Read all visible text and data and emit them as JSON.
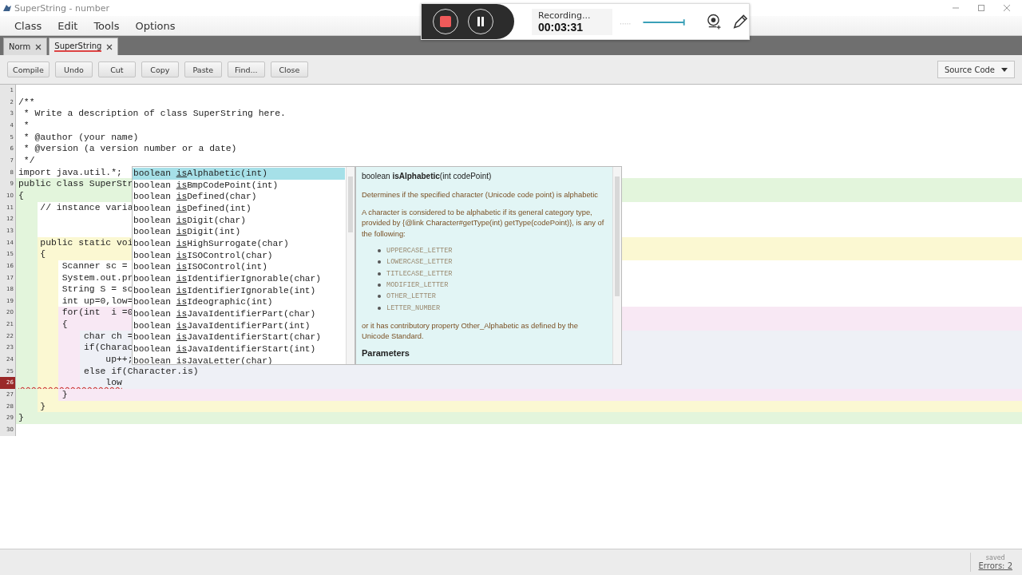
{
  "window": {
    "title": "SuperString - number"
  },
  "menu": [
    "Class",
    "Edit",
    "Tools",
    "Options"
  ],
  "tabs": [
    {
      "label": "Norm",
      "selected": false
    },
    {
      "label": "SuperString",
      "selected": true
    }
  ],
  "toolbar": {
    "buttons": [
      "Compile",
      "Undo",
      "Cut",
      "Copy",
      "Paste",
      "Find...",
      "Close"
    ],
    "view_selector": "Source Code"
  },
  "recorder": {
    "status": "Recording...",
    "time": "00:03:31",
    "paused": false
  },
  "editor": {
    "lines": [
      {
        "number": "1",
        "kind": "plain",
        "error": false
      },
      {
        "number": "2",
        "text": "/**",
        "kind": "plain",
        "error": false
      },
      {
        "number": "3",
        "text": " * Write a description of class SuperString here.",
        "kind": "plain",
        "error": false
      },
      {
        "number": "4",
        "text": " *",
        "kind": "plain",
        "error": false
      },
      {
        "number": "5",
        "text": " * @author (your name)",
        "kind": "plain",
        "error": false
      },
      {
        "number": "6",
        "text": " * @version (a version number or a date)",
        "kind": "plain",
        "error": false
      },
      {
        "number": "7",
        "text": " */",
        "kind": "plain",
        "error": false
      },
      {
        "number": "8",
        "text": "import java.util.*;",
        "kind": "plain",
        "error": false
      },
      {
        "number": "9",
        "text": "public class SuperStr",
        "kind": "class",
        "error": false
      },
      {
        "number": "10",
        "text": "{",
        "kind": "class",
        "error": false
      },
      {
        "number": "11",
        "text": "    // instance varia",
        "kind": "field",
        "error": false
      },
      {
        "number": "12",
        "kind": "field",
        "error": false
      },
      {
        "number": "13",
        "kind": "field",
        "error": false
      },
      {
        "number": "14",
        "text": "    public static voi",
        "kind": "method",
        "error": false
      },
      {
        "number": "15",
        "text": "    {",
        "kind": "method",
        "error": false
      },
      {
        "number": "16",
        "text": "        Scanner sc =",
        "kind": "body",
        "error": false
      },
      {
        "number": "17",
        "text": "        System.out.pr",
        "kind": "body",
        "error": false
      },
      {
        "number": "18",
        "text": "        String S = sc",
        "kind": "body",
        "error": false
      },
      {
        "number": "19",
        "text": "        int up=0,low=",
        "kind": "body",
        "error": false
      },
      {
        "number": "20",
        "text": "        for(int  i =0",
        "kind": "loop",
        "error": false
      },
      {
        "number": "21",
        "text": "        {",
        "kind": "loop",
        "error": false
      },
      {
        "number": "22",
        "text": "            char ch =",
        "kind": "inner",
        "error": false
      },
      {
        "number": "23",
        "text": "            if(Charac",
        "kind": "inner",
        "error": false
      },
      {
        "number": "24",
        "text": "                up++;",
        "kind": "inner",
        "error": false
      },
      {
        "number": "25",
        "text": "            else if(Character.is)",
        "kind": "inner",
        "error": false
      },
      {
        "number": "26",
        "text": "                low",
        "kind": "inner",
        "error": true
      },
      {
        "number": "27",
        "text": "        }",
        "kind": "loop",
        "error": false
      },
      {
        "number": "28",
        "text": "    }",
        "kind": "method",
        "error": false
      },
      {
        "number": "29",
        "text": "}",
        "kind": "class",
        "error": false
      },
      {
        "number": "30",
        "kind": "plain",
        "error": false
      }
    ]
  },
  "completion": {
    "items": [
      {
        "type": "boolean",
        "match": "is",
        "rest": "Alphabetic(int)",
        "selected": true
      },
      {
        "type": "boolean",
        "match": "is",
        "rest": "BmpCodePoint(int)",
        "selected": false
      },
      {
        "type": "boolean",
        "match": "is",
        "rest": "Defined(char)",
        "selected": false
      },
      {
        "type": "boolean",
        "match": "is",
        "rest": "Defined(int)",
        "selected": false
      },
      {
        "type": "boolean",
        "match": "is",
        "rest": "Digit(char)",
        "selected": false
      },
      {
        "type": "boolean",
        "match": "is",
        "rest": "Digit(int)",
        "selected": false
      },
      {
        "type": "boolean",
        "match": "is",
        "rest": "HighSurrogate(char)",
        "selected": false
      },
      {
        "type": "boolean",
        "match": "is",
        "rest": "ISOControl(char)",
        "selected": false
      },
      {
        "type": "boolean",
        "match": "is",
        "rest": "ISOControl(int)",
        "selected": false
      },
      {
        "type": "boolean",
        "match": "is",
        "rest": "IdentifierIgnorable(char)",
        "selected": false
      },
      {
        "type": "boolean",
        "match": "is",
        "rest": "IdentifierIgnorable(int)",
        "selected": false
      },
      {
        "type": "boolean",
        "match": "is",
        "rest": "Ideographic(int)",
        "selected": false
      },
      {
        "type": "boolean",
        "match": "is",
        "rest": "JavaIdentifierPart(char)",
        "selected": false
      },
      {
        "type": "boolean",
        "match": "is",
        "rest": "JavaIdentifierPart(int)",
        "selected": false
      },
      {
        "type": "boolean",
        "match": "is",
        "rest": "JavaIdentifierStart(char)",
        "selected": false
      },
      {
        "type": "boolean",
        "match": "is",
        "rest": "JavaIdentifierStart(int)",
        "selected": false
      },
      {
        "type": "boolean",
        "match": "is",
        "rest": "JavaLetter(char)",
        "selected": false
      }
    ],
    "doc": {
      "signature": "boolean **isAlphabetic**(int codePoint)",
      "summary": "Determines if the specified character (Unicode code point) is alphabetic",
      "paragraph": "A character is considered to be alphabetic if its general category type, provided by {@link Character#getType(int) getType(codePoint)}, is any of the following:",
      "bullets": [
        "UPPERCASE_LETTER",
        "LOWERCASE_LETTER",
        "TITLECASE_LETTER",
        "MODIFIER_LETTER",
        "OTHER_LETTER",
        "LETTER_NUMBER"
      ],
      "closing": "or it has contributory property Other_Alphabetic as defined by the Unicode Standard.",
      "heading": "Parameters"
    }
  },
  "status_bar": {
    "state": "saved",
    "errors": "Errors: 2"
  }
}
